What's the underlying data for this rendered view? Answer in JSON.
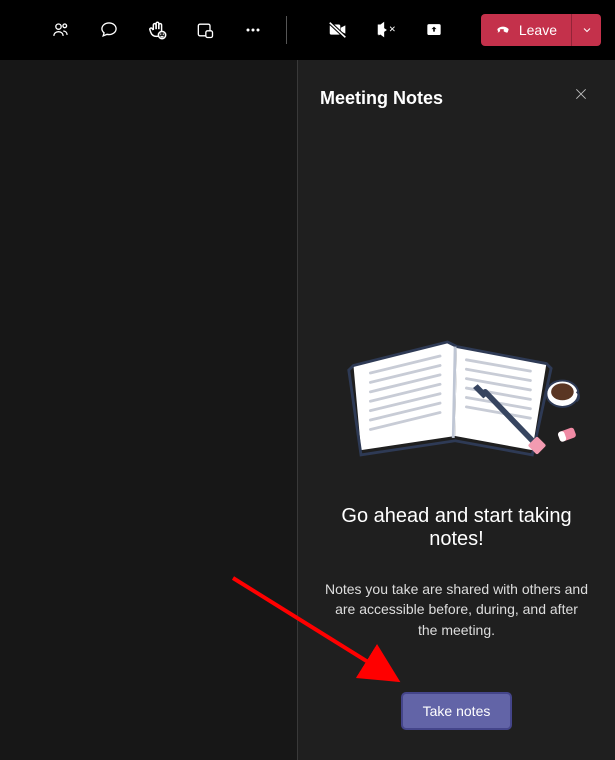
{
  "toolbar": {
    "leave_label": "Leave"
  },
  "panel": {
    "title": "Meeting Notes",
    "heading": "Go ahead and start taking notes!",
    "description": "Notes you take are shared with others and are accessible before, during, and after the meeting.",
    "button_label": "Take notes"
  }
}
